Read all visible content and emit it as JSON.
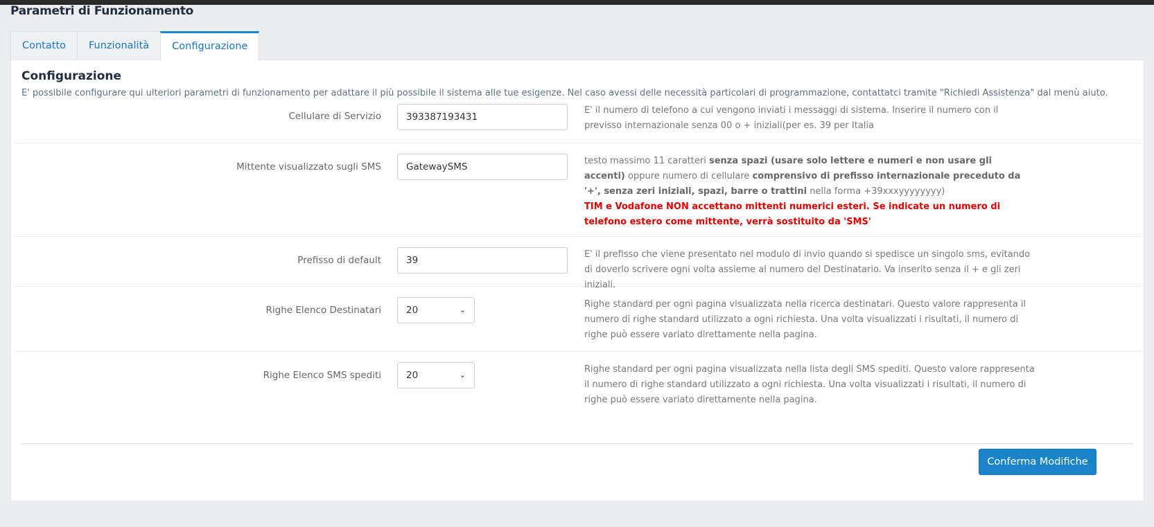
{
  "page": {
    "title": "Parametri di Funzionamento"
  },
  "tabs": [
    {
      "label": "Contatto"
    },
    {
      "label": "Funzionalità"
    },
    {
      "label": "Configurazione"
    }
  ],
  "section": {
    "title": "Configurazione",
    "description": "E' possibile configurare qui ulteriori parametri di funzionamento per adattare il più possibile il sistema alle tue esigenze. Nel caso avessi delle necessità particolari di programmazione, contattatci tramite \"Richiedi Assistenza\" dal menù aiuto."
  },
  "fields": {
    "cellulare": {
      "label": "Cellulare di Servizio",
      "value": "393387193431",
      "help": "E' il numero di telefono a cui vengono inviati i messaggi di sistema. Inserire il numero con il previsso internazionale senza 00 o + iniziali(per es. 39 per Italia"
    },
    "mittente": {
      "label": "Mittente visualizzato sugli SMS",
      "value": "GatewaySMS",
      "help_1": "testo massimo 11 caratteri ",
      "help_2": "senza spazi (usare solo lettere e numeri e non usare gli accenti)",
      "help_3": " oppure numero di cellulare ",
      "help_4": "comprensivo di prefisso internazionale preceduto da '+', senza zeri iniziali, spazi, barre o trattini",
      "help_5": " nella forma +39xxxyyyyyyyy)",
      "warning": "TIM e Vodafone NON accettano mittenti numerici esteri. Se indicate un numero di telefono estero come mittente, verrà sostituito da 'SMS'"
    },
    "prefisso": {
      "label": "Prefisso di default",
      "value": "39",
      "help": "E' il prefisso che viene presentato nel modulo di invio quando si spedisce un singolo sms, evitando di doverlo scrivere ogni volta assieme al numero del Destinatario. Va inserito senza il + e gli zeri iniziali."
    },
    "righe_destinatari": {
      "label": "Righe Elenco Destinatari",
      "value": "20",
      "help": "Righe standard per ogni pagina visualizzata nella ricerca destinatari. Questo valore rappresenta il numero di righe standard utilizzato a ogni richiesta. Una volta visualizzati i risultati, il numero di righe può essere variato direttamente nella pagina."
    },
    "righe_sms": {
      "label": "Righe Elenco SMS spediti",
      "value": "20",
      "help": "Righe standard per ogni pagina visualizzata nella lista degli SMS spediti. Questo valore rappresenta il numero di righe standard utilizzato a ogni richiesta. Una volta visualizzati i risultati, il numero di righe può essere variato direttamente nella pagina."
    }
  },
  "actions": {
    "confirm_label": "Conferma Modifiche"
  },
  "icons": {
    "select_chevron": "chevron-down-icon"
  },
  "colors": {
    "accent": "#1985c8",
    "warning": "#e00000",
    "background": "#ebedf0"
  }
}
